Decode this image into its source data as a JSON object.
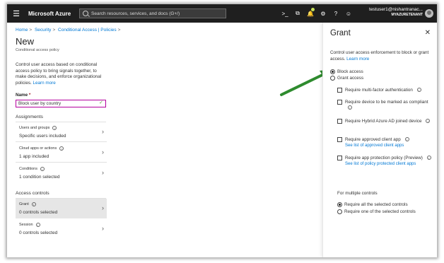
{
  "topbar": {
    "brand": "Microsoft Azure",
    "search_placeholder": "Search resources, services, and docs (G+/)",
    "user_name": "testuser1@nishantranac...",
    "tenant": "MYAZURETENANT"
  },
  "breadcrumb": [
    "Home",
    "Security",
    "Conditional Access | Policies"
  ],
  "page": {
    "title": "New",
    "subtitle": "Conditional access policy",
    "description": "Control user access based on conditional access policy to bring signals together, to make decisions, and enforce organizational policies.",
    "learn_more": "Learn more",
    "name_label": "Name",
    "name_required": "*",
    "name_value": "Block user by country",
    "assignments_label": "Assignments",
    "access_controls_label": "Access controls",
    "rows": [
      {
        "title": "Users and groups",
        "value": "Specific users included"
      },
      {
        "title": "Cloud apps or actions",
        "value": "1 app included"
      },
      {
        "title": "Conditions",
        "value": "1 condition selected"
      },
      {
        "title": "Grant",
        "value": "0 controls selected"
      },
      {
        "title": "Session",
        "value": "0 controls selected"
      }
    ]
  },
  "grant": {
    "title": "Grant",
    "description": "Control user access enforcement to block or grant access.",
    "learn_more": "Learn more",
    "block_access": "Block access",
    "grant_access": "Grant access",
    "block_selected": true,
    "controls": [
      {
        "label": "Require multi-factor authentication",
        "link": ""
      },
      {
        "label": "Require device to be marked as compliant",
        "link": ""
      },
      {
        "label": "Require Hybrid Azure AD joined device",
        "link": ""
      },
      {
        "label": "Require approved client app",
        "link": "See list of approved client apps"
      },
      {
        "label": "Require app protection policy (Preview)",
        "link": "See list of policy protected client apps"
      }
    ],
    "multiple_label": "For multiple controls",
    "require_all": "Require all the selected controls",
    "require_one": "Require one of the selected controls"
  },
  "colors": {
    "accent": "#0078d4",
    "topbar": "#1f1f1f",
    "arrow": "#2e8b2e"
  }
}
